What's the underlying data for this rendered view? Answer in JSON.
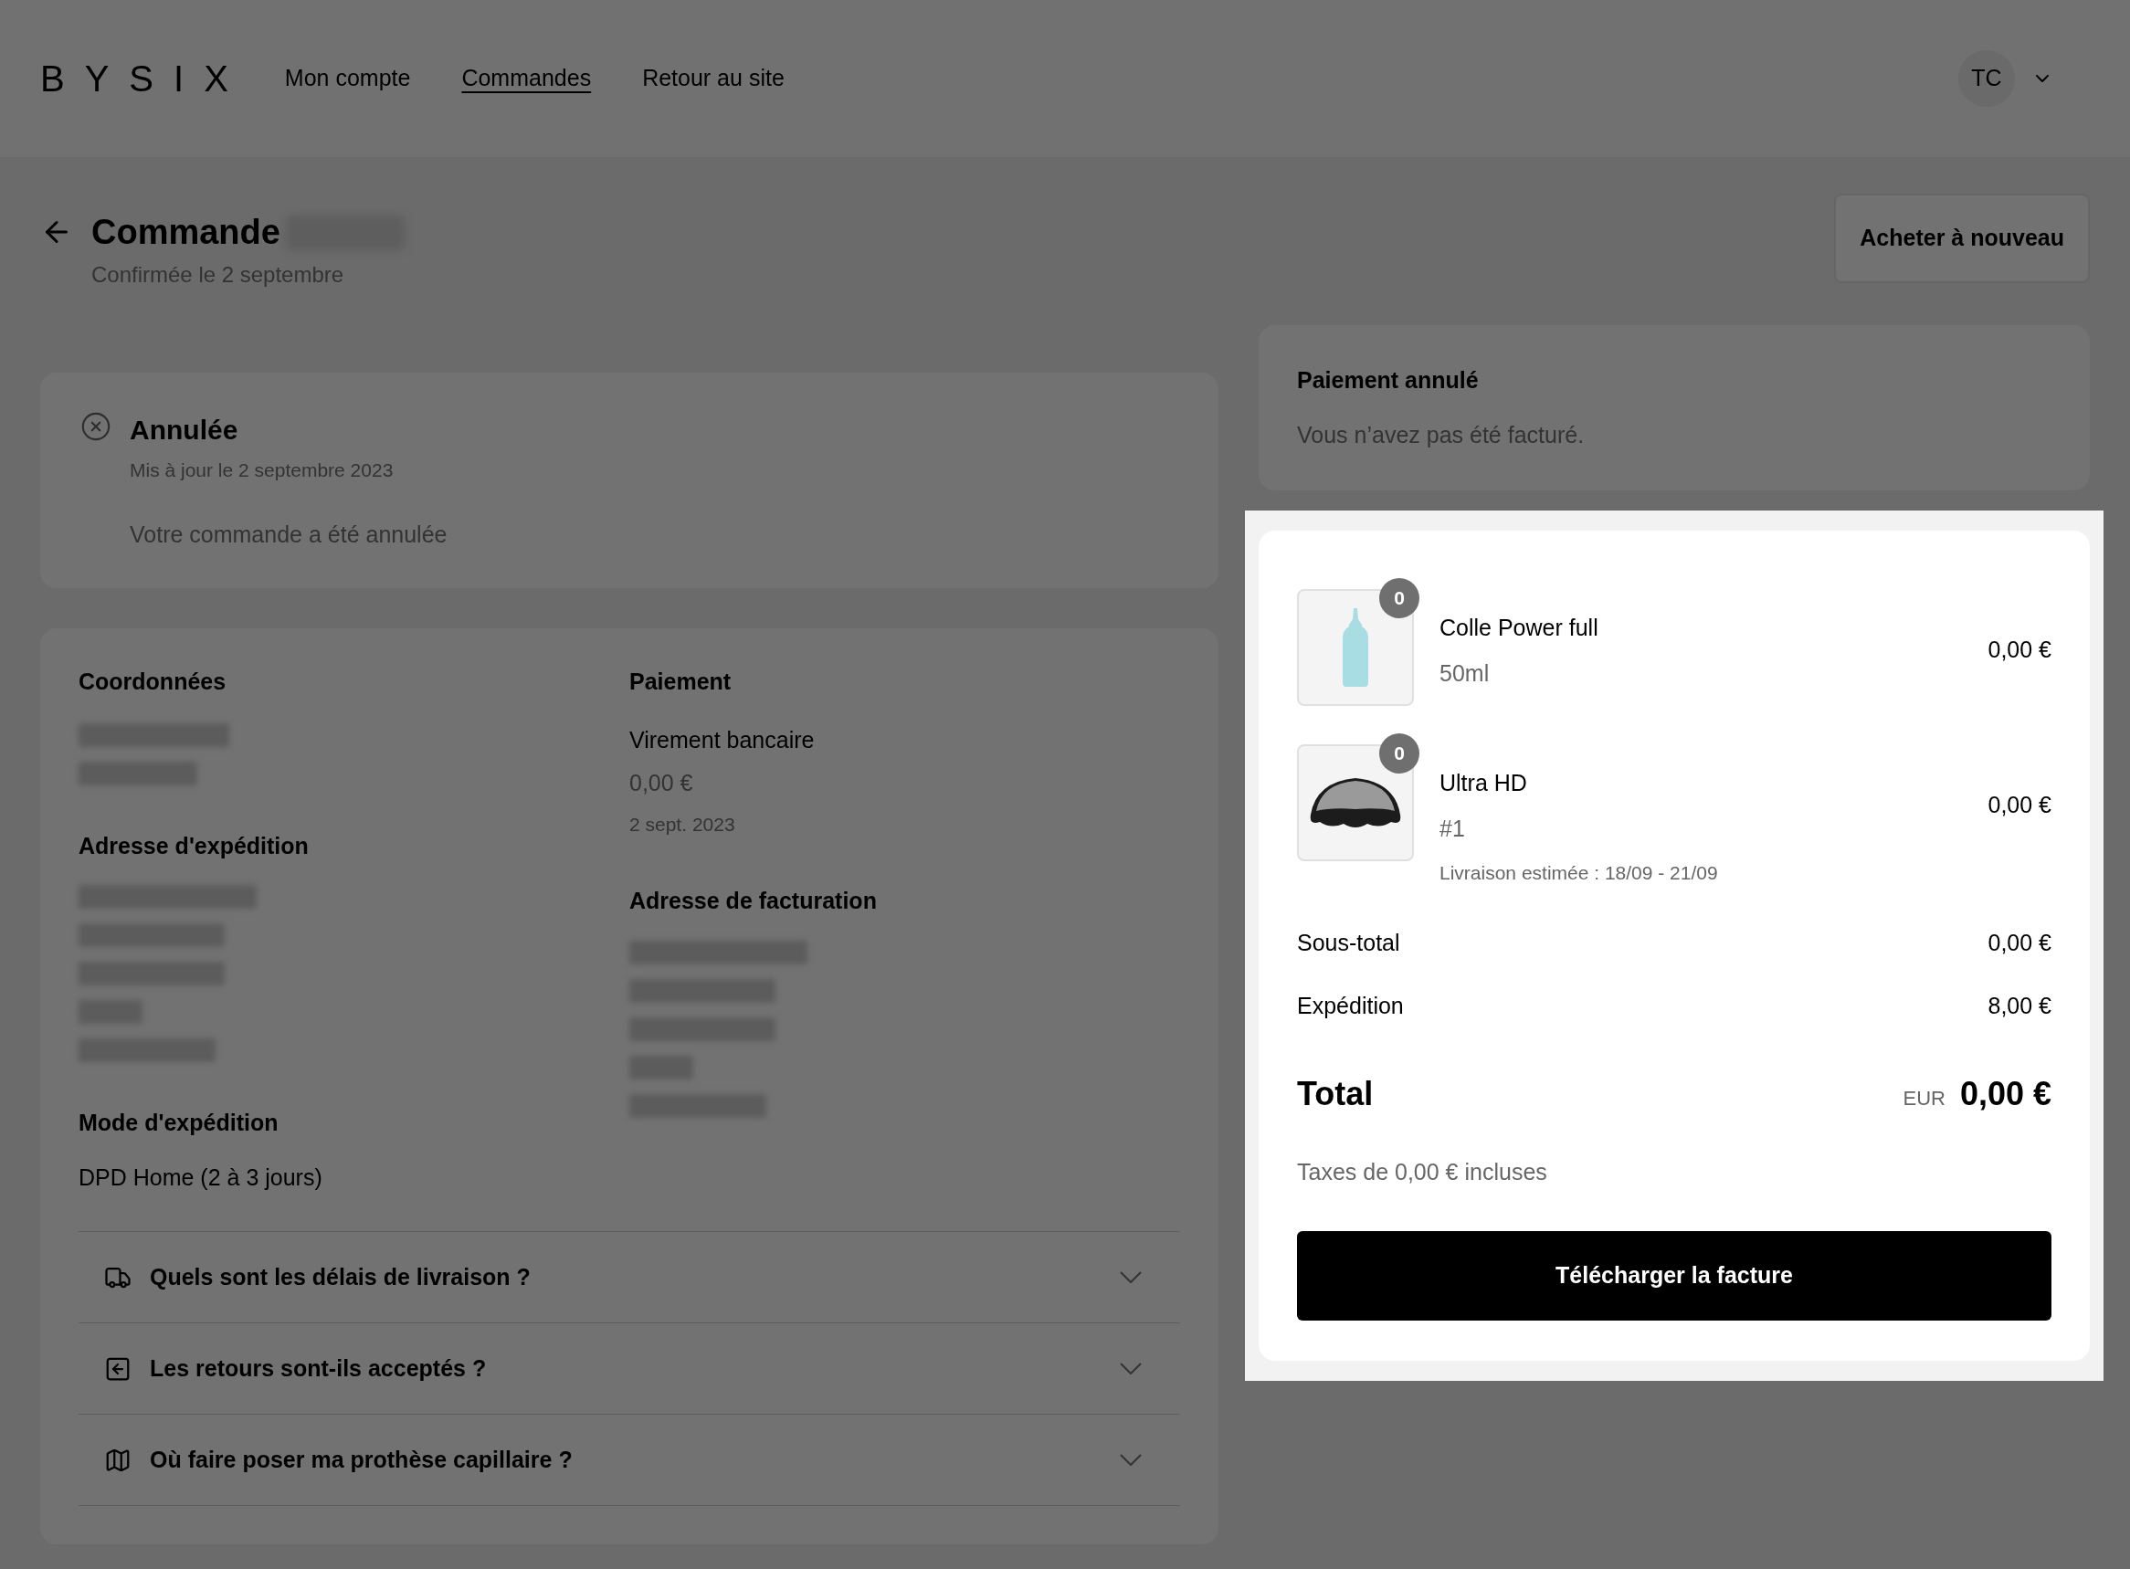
{
  "header": {
    "logo": "BYSIX",
    "nav": [
      {
        "label": "Mon compte",
        "selected": false
      },
      {
        "label": "Commandes",
        "selected": true
      },
      {
        "label": "Retour au site",
        "selected": false
      }
    ],
    "avatar": "TC"
  },
  "page": {
    "title": "Commande",
    "subtitle": "Confirmée le 2 septembre",
    "reorder_button": "Acheter à nouveau"
  },
  "status": {
    "title": "Annulée",
    "updated": "Mis à jour le 2 septembre 2023",
    "message": "Votre commande a été annulée"
  },
  "details": {
    "contact": {
      "heading": "Coordonnées"
    },
    "shipping_address": {
      "heading": "Adresse d'expédition"
    },
    "shipping_method": {
      "heading": "Mode d'expédition",
      "value": "DPD Home (2 à 3 jours)"
    },
    "payment": {
      "heading": "Paiement",
      "method": "Virement bancaire",
      "amount": "0,00 €",
      "date": "2 sept. 2023"
    },
    "billing_address": {
      "heading": "Adresse de facturation"
    }
  },
  "faq": [
    {
      "kind": "truck",
      "question": "Quels sont les délais de livraison ?",
      "expanded": false
    },
    {
      "kind": "return",
      "question": "Les retours sont-ils acceptés ?",
      "expanded": false
    },
    {
      "kind": "map",
      "question": "Où faire poser ma prothèse capillaire ?",
      "expanded": false
    }
  ],
  "payment_notice": {
    "title": "Paiement annulé",
    "message": "Vous n’avez pas été facturé."
  },
  "summary": {
    "items": [
      {
        "kind": "bottle",
        "name": "Colle Power full",
        "variant": "50ml",
        "quantity": "0",
        "price": "0,00 €"
      },
      {
        "kind": "hairpiece",
        "name": "Ultra HD",
        "variant": "#1",
        "delivery": "Livraison estimée : 18/09 - 21/09",
        "quantity": "0",
        "price": "0,00 €"
      }
    ],
    "subtotal": {
      "label": "Sous-total",
      "value": "0,00 €"
    },
    "shipping": {
      "label": "Expédition",
      "value": "8,00 €"
    },
    "total": {
      "label": "Total",
      "currency": "EUR",
      "value": "0,00 €"
    },
    "taxes": "Taxes de 0,00 € incluses",
    "download_button": "Télécharger la facture"
  }
}
